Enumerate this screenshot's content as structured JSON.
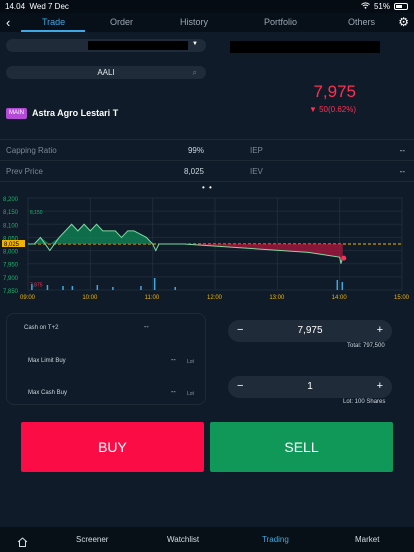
{
  "status_bar": {
    "time": "14.04",
    "date": "Wed 7 Dec",
    "battery": "51%"
  },
  "nav": {
    "tabs": [
      "Trade",
      "Order",
      "History",
      "Portfolio",
      "Others"
    ]
  },
  "search": {
    "value": "AALI"
  },
  "stock": {
    "badge": "MAIN",
    "name": "Astra Agro Lestari T",
    "price": "7,975",
    "change": "▼ 50(0.62%)"
  },
  "info": {
    "capping_ratio_label": "Capping Ratio",
    "capping_ratio_value": "99%",
    "iep_label": "IEP",
    "iep_value": "--",
    "prev_price_label": "Prev Price",
    "prev_price_value": "8,025",
    "iev_label": "IEV",
    "iev_value": "--"
  },
  "chart_data": {
    "type": "line",
    "y_ticks": [
      "8,200",
      "8,150",
      "8,100",
      "8,050",
      "8,000",
      "7,950",
      "7,900",
      "7,850"
    ],
    "x_ticks": [
      "09:00",
      "10:00",
      "11:00",
      "12:00",
      "13:00",
      "14:00",
      "15:00"
    ],
    "high_label": "8,150",
    "low_label": "7,875",
    "prev_label": "8,025",
    "ylim": [
      7850,
      8200
    ],
    "prev_close": 8025,
    "series": [
      {
        "values": [
          [
            9.0,
            8025
          ],
          [
            9.1,
            8025
          ],
          [
            9.2,
            8050
          ],
          [
            9.35,
            8000
          ],
          [
            9.5,
            8050
          ],
          [
            9.6,
            8075
          ],
          [
            9.7,
            8100
          ],
          [
            9.8,
            8075
          ],
          [
            9.9,
            8100
          ],
          [
            10.0,
            8075
          ],
          [
            10.1,
            8100
          ],
          [
            10.2,
            8075
          ],
          [
            10.3,
            8075
          ],
          [
            10.4,
            8075
          ],
          [
            10.5,
            8050
          ],
          [
            10.6,
            8075
          ],
          [
            10.7,
            8075
          ],
          [
            10.9,
            8050
          ],
          [
            11.0,
            8025
          ],
          [
            11.05,
            8000
          ],
          [
            11.1,
            8025
          ],
          [
            11.3,
            8025
          ],
          [
            11.5,
            8025
          ],
          [
            13.5,
            7993
          ],
          [
            14.0,
            7975
          ],
          [
            14.02,
            7950
          ],
          [
            14.05,
            7975
          ]
        ]
      }
    ]
  },
  "order": {
    "cash_label": "Cash on T+2",
    "cash_value": "--",
    "max_limit_label": "Max Limit Buy",
    "max_limit_value": "--",
    "max_cash_label": "Max Cash Buy",
    "max_cash_value": "--",
    "lot_unit": "Lot",
    "minus": "−",
    "plus": "+",
    "price_value": "7,975",
    "total_note": "Total: 797,500",
    "lot_value": "1",
    "lot_note": "Lot: 100 Shares"
  },
  "buttons": {
    "buy": "BUY",
    "sell": "SELL"
  },
  "bottom_nav": {
    "items": [
      "Screener",
      "Watchlist",
      "Trading",
      "Market"
    ]
  },
  "colors": {
    "accent": "#3ea8e5",
    "down": "#ff2f55",
    "buy": "#fc0c45",
    "sell": "#0f9858",
    "up": "#19b56c"
  }
}
